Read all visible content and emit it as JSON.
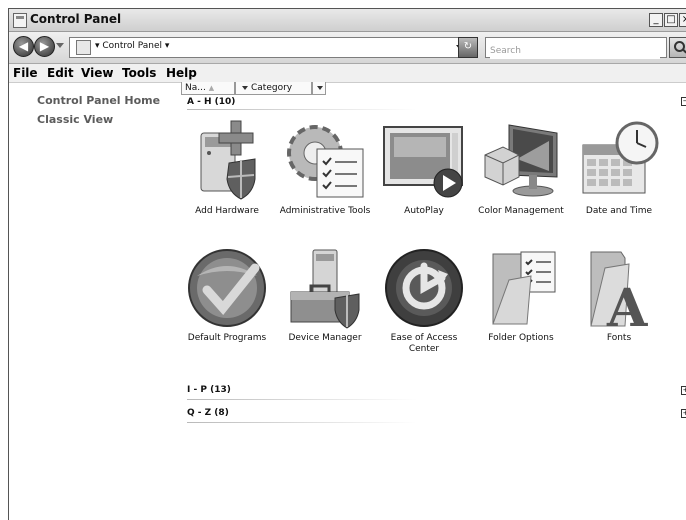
{
  "window": {
    "title": "Control Panel",
    "controls": [
      "_",
      "□",
      "×"
    ]
  },
  "address": {
    "back": "◀",
    "forward": "▶",
    "path": "▾ Control Panel ▾"
  },
  "search": {
    "placeholder": "Search"
  },
  "menu": [
    "File",
    "Edit",
    "View",
    "Tools",
    "Help"
  ],
  "sidebar": {
    "links": [
      "Control Panel Home",
      "Classic View"
    ]
  },
  "columns": {
    "name": "Na...",
    "category": "Category"
  },
  "groups": [
    {
      "label": "A - H (10)",
      "collapsed": false
    },
    {
      "label": "I - P (13)",
      "collapsed": true
    },
    {
      "label": "Q - Z (8)",
      "collapsed": true
    }
  ],
  "items": [
    {
      "label": "Add Hardware",
      "icon": "add-hardware-icon"
    },
    {
      "label": "Administrative Tools",
      "icon": "administrative-tools-icon"
    },
    {
      "label": "AutoPlay",
      "icon": "autoplay-icon"
    },
    {
      "label": "Color Management",
      "icon": "color-management-icon"
    },
    {
      "label": "Date and Time",
      "icon": "date-and-time-icon"
    },
    {
      "label": "Default Programs",
      "icon": "default-programs-icon"
    },
    {
      "label": "Device Manager",
      "icon": "device-manager-icon"
    },
    {
      "label": "Ease of Access Center",
      "icon": "ease-of-access-icon"
    },
    {
      "label": "Folder Options",
      "icon": "folder-options-icon"
    },
    {
      "label": "Fonts",
      "icon": "fonts-icon"
    }
  ]
}
